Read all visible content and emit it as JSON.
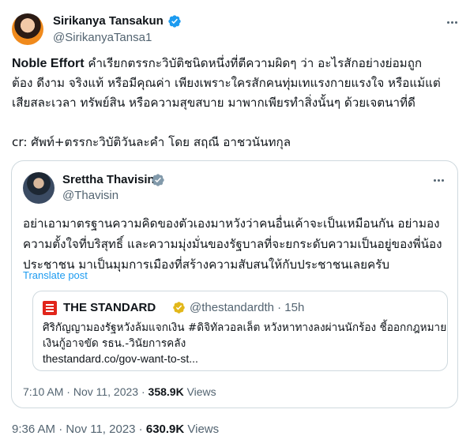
{
  "tweet": {
    "author_name": "Sirikanya Tansakun",
    "author_handle": "@SirikanyaTansa1",
    "body_lead": "Noble Effort",
    "body_line1_rest": " คำเรียกตรรกะวิบัติชนิดหนึ่งที่ตีความผิดๆ ว่า อะไรสักอย่างย่อมถูก",
    "body_line2": "ต้อง ดีงาม จริงแท้ หรือมีคุณค่า เพียงเพราะใครสักคนทุ่มเทแรงกายแรงใจ หรือแม้แต่",
    "body_line3": "เสียสละเวลา ทรัพย์สิน หรือความสุขสบาย มาพากเพียรทำสิ่งนั้นๆ ด้วยเจตนาที่ดี",
    "credit": "cr: ศัพท์+ตรรกะวิบัติวันละคำ โดย สฤณี อาชวนันทกุล",
    "time": "9:36 AM",
    "dot": " · ",
    "date": "Nov 11, 2023",
    "dot2": " · ",
    "views_count": "630.9K",
    "views_label": " Views"
  },
  "quoted": {
    "author_name": "Srettha Thavisin",
    "author_handle": "@Thavisin",
    "line1": "อย่าเอามาตรฐานความคิดของตัวเองมาหวังว่าคนอื่นเค้าจะเป็นเหมือนกัน อย่ามอง",
    "line2": "ความตั้งใจที่บริสุทธิ์ และความมุ่งมั่นของรัฐบาลที่จะยกระดับความเป็นอยู่ของพี่น้อง",
    "line3": "ประชาชน มาเป็นมุมการเมืองที่สร้างความสับสนให้กับประชาชนเลยครับ",
    "translate": "Translate post",
    "time": "7:10 AM",
    "dot": " · ",
    "date": "Nov 11, 2023",
    "dot2": " · ",
    "views_count": "358.9K",
    "views_label": " Views",
    "card": {
      "source": "THE STANDARD",
      "handle_time": "@thestandardth · 15h",
      "line1": "ศิริกัญญามองรัฐหวังล้มแจกเงิน #ดิจิทัลวอลเล็ต หวังหาทางลงผ่านนักร้อง ชี้ออกกฎหมาย",
      "line2": "เงินกู้อาจขัด รธน.-วินัยการคลัง",
      "link": "thestandard.co/gov-want-to-st..."
    }
  },
  "colors": {
    "text": "#0f1419",
    "secondary": "#536471",
    "link": "#1d9bf0",
    "verified": "#1d9bf0",
    "gold_badge": "#e2b719",
    "border": "#cfd9de",
    "standard_red": "#e1251b"
  },
  "icons": [
    "verified-badge-icon",
    "gold-verified-badge-icon",
    "more-options-icon",
    "the-standard-logo-icon"
  ]
}
